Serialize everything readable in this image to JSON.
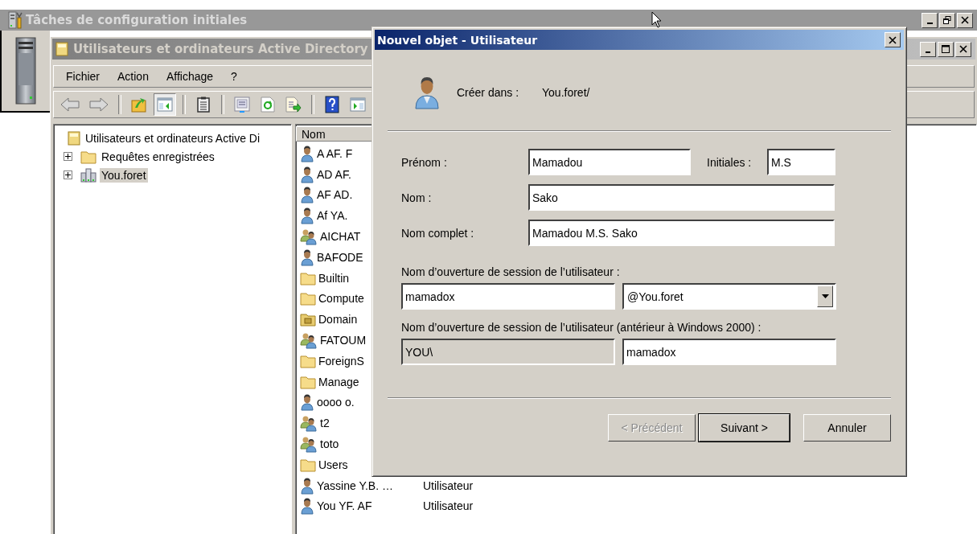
{
  "background_window": {
    "title": "Tâches de configuration initiales"
  },
  "ad_window": {
    "title": "Utilisateurs et ordinateurs Active Directory",
    "menu": [
      "Fichier",
      "Action",
      "Affichage",
      "?"
    ],
    "toolbar": [
      [
        {
          "kind": "back",
          "pressed": false
        },
        {
          "kind": "forward",
          "pressed": false
        }
      ],
      [
        {
          "kind": "up",
          "pressed": false
        },
        {
          "kind": "tree",
          "pressed": true
        }
      ],
      [
        {
          "kind": "clipboard",
          "pressed": false
        }
      ],
      [
        {
          "kind": "properties",
          "pressed": false
        },
        {
          "kind": "refresh",
          "pressed": false
        },
        {
          "kind": "export",
          "pressed": false
        }
      ],
      [
        {
          "kind": "help",
          "pressed": false
        },
        {
          "kind": "pane",
          "pressed": false
        }
      ]
    ],
    "tree": {
      "label": "Utilisateurs et ordinateurs Active Di",
      "selected": false,
      "children": [
        {
          "label": "Requêtes enregistrées",
          "kind": "folder",
          "expanded": false,
          "selected": false
        },
        {
          "label": "You.foret",
          "kind": "domain",
          "expanded": false,
          "selected": true
        }
      ]
    },
    "list": {
      "columns": [
        "Nom"
      ],
      "rows": [
        {
          "name": "A AF. F",
          "kind": "user"
        },
        {
          "name": "AD AF.",
          "kind": "user"
        },
        {
          "name": "AF AD.",
          "kind": "user"
        },
        {
          "name": "Af YA.",
          "kind": "user"
        },
        {
          "name": "AICHAT",
          "kind": "group"
        },
        {
          "name": "BAFODE",
          "kind": "user"
        },
        {
          "name": "Builtin",
          "kind": "folder"
        },
        {
          "name": "Compute",
          "kind": "folder"
        },
        {
          "name": "Domain",
          "kind": "ou"
        },
        {
          "name": "FATOUM",
          "kind": "group"
        },
        {
          "name": "ForeignS",
          "kind": "folder"
        },
        {
          "name": "Manage",
          "kind": "folder"
        },
        {
          "name": "oooo o.",
          "kind": "user"
        },
        {
          "name": "t2",
          "kind": "group"
        },
        {
          "name": "toto",
          "kind": "group"
        },
        {
          "name": "Users",
          "kind": "folder"
        },
        {
          "name": "Yassine Y.B. …",
          "kind": "user",
          "type": "Utilisateur"
        },
        {
          "name": "You YF. AF",
          "kind": "user",
          "type": "Utilisateur"
        }
      ]
    }
  },
  "dialog": {
    "title": "Nouvel objet - Utilisateur",
    "create_in_label": "Créer dans :",
    "create_in_value": "You.foret/",
    "first_name": {
      "label": "Prénom :",
      "value": "Mamadou"
    },
    "initials": {
      "label": "Initiales :",
      "value": "M.S"
    },
    "last_name": {
      "label": "Nom :",
      "value": "Sako"
    },
    "full_name": {
      "label": "Nom complet :",
      "value": "Mamadou M.S. Sako"
    },
    "logon": {
      "label": "Nom d’ouverture de session de l’utilisateur :",
      "value": "mamadox",
      "domain": "@You.foret"
    },
    "logon_pre2000": {
      "label": "Nom d’ouverture de session de l’utilisateur (antérieur à Windows 2000) :",
      "fields": [
        {
          "value": "YOU\\",
          "disabled": true
        },
        {
          "value": "mamadox",
          "disabled": false
        }
      ]
    },
    "buttons": [
      {
        "label": "< Précédent",
        "disabled": true,
        "default": false
      },
      {
        "label": "Suivant >",
        "disabled": false,
        "default": true
      },
      {
        "label": "Annuler",
        "disabled": false,
        "default": false
      }
    ]
  }
}
